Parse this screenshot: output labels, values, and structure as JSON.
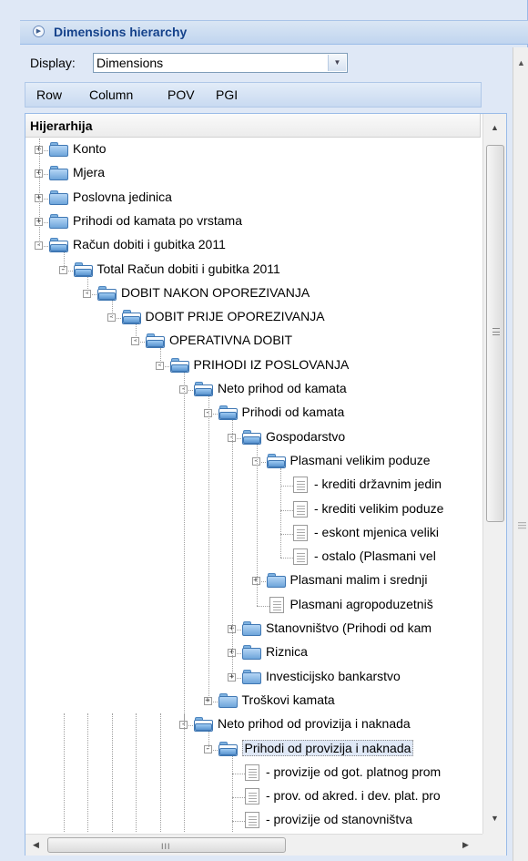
{
  "panel": {
    "title": "Dimensions hierarchy",
    "display_label": "Display:",
    "display_value": "Dimensions",
    "toolbar": [
      "Row",
      "Column",
      "POV",
      "PGI"
    ]
  },
  "tree": {
    "header": "Hijerarhija",
    "rows": [
      {
        "label": "Konto",
        "depth": 0,
        "type": "folder",
        "toggle": "+"
      },
      {
        "label": "Mjera",
        "depth": 0,
        "type": "folder",
        "toggle": "+"
      },
      {
        "label": "Poslovna jedinica",
        "depth": 0,
        "type": "folder",
        "toggle": "+"
      },
      {
        "label": "Prihodi od kamata po vrstama",
        "depth": 0,
        "type": "folder",
        "toggle": "+"
      },
      {
        "label": "Račun dobiti i gubitka 2011",
        "depth": 0,
        "type": "folder-open",
        "toggle": "-"
      },
      {
        "label": "Total Račun dobiti i gubitka 2011",
        "depth": 1,
        "type": "folder-open",
        "toggle": "-"
      },
      {
        "label": "DOBIT NAKON OPOREZIVANJA",
        "depth": 2,
        "type": "folder-open",
        "toggle": "-"
      },
      {
        "label": "DOBIT PRIJE OPOREZIVANJA",
        "depth": 3,
        "type": "folder-open",
        "toggle": "-"
      },
      {
        "label": "OPERATIVNA DOBIT",
        "depth": 4,
        "type": "folder-open",
        "toggle": "-"
      },
      {
        "label": "PRIHODI IZ POSLOVANJA",
        "depth": 5,
        "type": "folder-open",
        "toggle": "-"
      },
      {
        "label": "Neto prihod od kamata",
        "depth": 6,
        "type": "folder-open",
        "toggle": "-"
      },
      {
        "label": "Prihodi od kamata",
        "depth": 7,
        "type": "folder-open",
        "toggle": "-"
      },
      {
        "label": "Gospodarstvo",
        "depth": 8,
        "type": "folder-open",
        "toggle": "-"
      },
      {
        "label": "Plasmani velikim poduze",
        "depth": 9,
        "type": "folder-open",
        "toggle": "-"
      },
      {
        "label": "- krediti državnim jedin",
        "depth": 10,
        "type": "leaf",
        "toggle": ""
      },
      {
        "label": "- krediti velikim poduze",
        "depth": 10,
        "type": "leaf",
        "toggle": ""
      },
      {
        "label": "- eskont mjenica veliki",
        "depth": 10,
        "type": "leaf",
        "toggle": ""
      },
      {
        "label": "- ostalo (Plasmani vel",
        "depth": 10,
        "type": "leaf",
        "toggle": ""
      },
      {
        "label": "Plasmani malim i srednji",
        "depth": 9,
        "type": "folder",
        "toggle": "+"
      },
      {
        "label": "Plasmani agropoduzetniš",
        "depth": 9,
        "type": "leaf",
        "toggle": ""
      },
      {
        "label": "Stanovništvo (Prihodi od kam",
        "depth": 8,
        "type": "folder",
        "toggle": "+"
      },
      {
        "label": "Riznica",
        "depth": 8,
        "type": "folder",
        "toggle": "+"
      },
      {
        "label": "Investicijsko bankarstvo",
        "depth": 8,
        "type": "folder",
        "toggle": "+"
      },
      {
        "label": "Troškovi kamata",
        "depth": 7,
        "type": "folder",
        "toggle": "+"
      },
      {
        "label": "Neto prihod od provizija i naknada",
        "depth": 6,
        "type": "folder-open",
        "toggle": "-"
      },
      {
        "label": "Prihodi od provizija i naknada",
        "depth": 7,
        "type": "folder-open",
        "toggle": "-",
        "selected": true
      },
      {
        "label": "- provizije od got. platnog prom",
        "depth": 8,
        "type": "leaf",
        "toggle": ""
      },
      {
        "label": "- prov. od akred. i dev. plat. pro",
        "depth": 8,
        "type": "leaf",
        "toggle": ""
      },
      {
        "label": "- provizije od stanovništva",
        "depth": 8,
        "type": "leaf",
        "toggle": ""
      }
    ]
  }
}
